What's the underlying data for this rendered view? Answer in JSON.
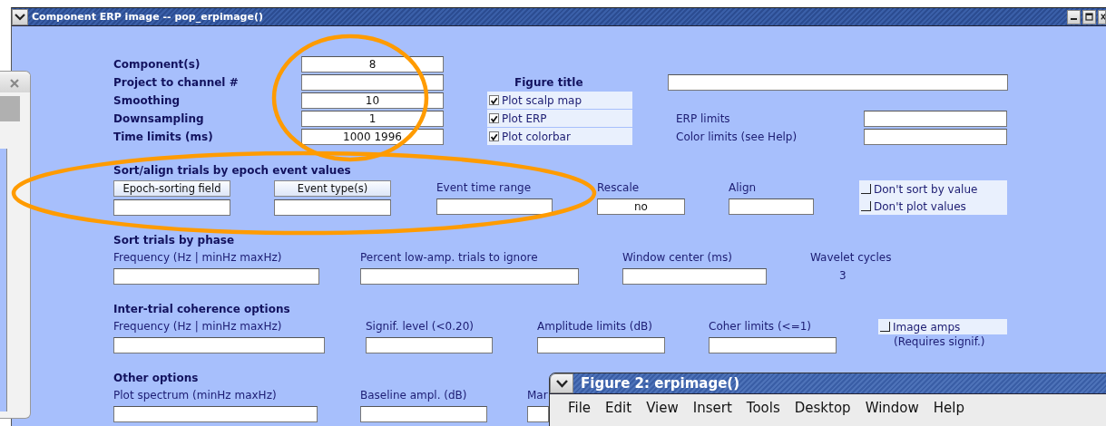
{
  "window": {
    "title": "Component ERP image -- pop_erpimage()"
  },
  "main_fields": [
    {
      "label": "Component(s)",
      "value": "8"
    },
    {
      "label": "Project to channel #"
    },
    {
      "label": "Smoothing",
      "value": "10"
    },
    {
      "label": "Downsampling",
      "value": "1"
    },
    {
      "label": "Time limits (ms)",
      "value": "1000 1996"
    }
  ],
  "figure_title": {
    "label": "Figure title"
  },
  "plot_options": [
    {
      "label": "Plot scalp map",
      "checked": true
    },
    {
      "label": "Plot ERP",
      "checked": true
    },
    {
      "label": "Plot colorbar",
      "checked": true
    }
  ],
  "limits": [
    {
      "label": "ERP limits"
    },
    {
      "label": "Color limits (see Help)"
    }
  ],
  "sections": [
    {
      "title": "Sort/align trials by epoch event values",
      "items": [
        {
          "kind": "button",
          "label": "Epoch-sorting field"
        },
        {
          "kind": "button",
          "label": "Event type(s)"
        },
        {
          "kind": "field",
          "label": "Event time range"
        },
        {
          "kind": "field",
          "label": "Rescale",
          "value": "no"
        },
        {
          "kind": "field",
          "label": "Align"
        },
        {
          "kind": "checks",
          "options": [
            {
              "label": "Don't sort by value",
              "checked": false
            },
            {
              "label": "Don't plot values",
              "checked": false
            }
          ]
        }
      ]
    },
    {
      "title": "Sort trials by phase",
      "items": [
        {
          "kind": "field",
          "label": "Frequency (Hz | minHz maxHz)"
        },
        {
          "kind": "field",
          "label": "Percent low-amp. trials to ignore"
        },
        {
          "kind": "field",
          "label": "Window center (ms)"
        },
        {
          "kind": "reading",
          "label": "Wavelet cycles",
          "value": "3"
        }
      ]
    },
    {
      "title": "Inter-trial coherence options",
      "items": [
        {
          "kind": "field",
          "label": "Frequency (Hz | minHz maxHz)"
        },
        {
          "kind": "field",
          "label": "Signif. level (<0.20)"
        },
        {
          "kind": "field",
          "label": "Amplitude limits (dB)"
        },
        {
          "kind": "field",
          "label": "Coher limits (<=1)"
        },
        {
          "kind": "checks",
          "options": [
            {
              "label": "Image amps",
              "checked": false
            }
          ],
          "note": "(Requires signif.)"
        }
      ]
    },
    {
      "title": "Other options",
      "items": [
        {
          "kind": "field",
          "label": "Plot spectrum (minHz maxHz)"
        },
        {
          "kind": "field",
          "label": "Baseline ampl. (dB)"
        },
        {
          "kind": "field",
          "label": "Mar"
        }
      ]
    }
  ],
  "figure_window": {
    "title": "Figure 2:  erpimage()",
    "menu": [
      "File",
      "Edit",
      "View",
      "Insert",
      "Tools",
      "Desktop",
      "Window",
      "Help"
    ]
  }
}
